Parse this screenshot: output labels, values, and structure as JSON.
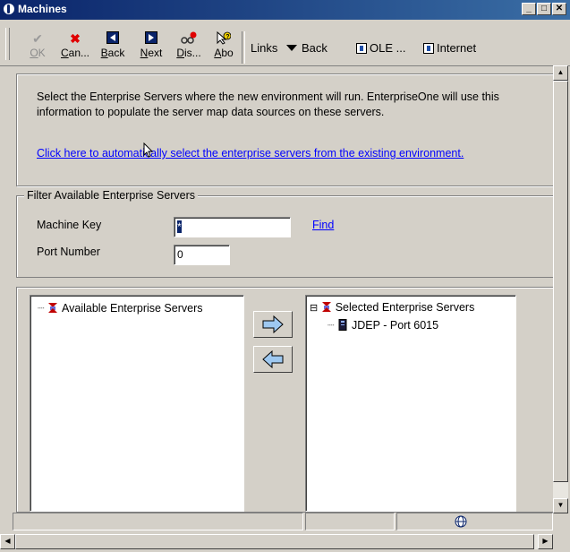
{
  "window": {
    "title": "Machines"
  },
  "window_buttons": {
    "minimize": "_",
    "maximize": "□",
    "close": "✕"
  },
  "toolbar": {
    "buttons": [
      {
        "label": "OK",
        "mnemonic": "O",
        "rest": "K",
        "icon": "check-icon",
        "enabled": false
      },
      {
        "label": "Can...",
        "mnemonic": "C",
        "rest": "an...",
        "icon": "cancel-x-icon",
        "enabled": true
      },
      {
        "label": "Back",
        "mnemonic": "B",
        "rest": "ack",
        "icon": "back-icon",
        "enabled": true
      },
      {
        "label": "Next",
        "mnemonic": "N",
        "rest": "ext",
        "icon": "next-icon",
        "enabled": true
      },
      {
        "label": "Dis...",
        "mnemonic": "D",
        "rest": "is...",
        "icon": "display-icon",
        "enabled": true
      },
      {
        "label": "Abo",
        "mnemonic": "A",
        "rest": "bo",
        "icon": "about-icon",
        "enabled": true
      }
    ],
    "links_label": "Links",
    "back_label": "Back",
    "ole_label": "OLE ...",
    "internet_label": "Internet"
  },
  "instructions": {
    "text": "Select the Enterprise Servers where the new environment will run.  EnterpriseOne will use this information to populate the server map data sources on these servers.",
    "auto_select_link": "Click here to automatically select the enterprise servers from the existing environment."
  },
  "filter": {
    "title": "Filter Available Enterprise Servers",
    "machine_key_label": "Machine Key",
    "machine_key_value": "*",
    "port_number_label": "Port Number",
    "port_number_value": "0",
    "find_label": "Find"
  },
  "available_servers": {
    "root_label": "Available Enterprise Servers",
    "items": []
  },
  "selected_servers": {
    "root_label": "Selected Enterprise Servers",
    "expander": "⊟",
    "items": [
      {
        "label": "JDEP - Port 6015"
      }
    ]
  },
  "colors": {
    "accent": "#0a246a",
    "link": "#0000ff",
    "face": "#d4d0c8"
  }
}
